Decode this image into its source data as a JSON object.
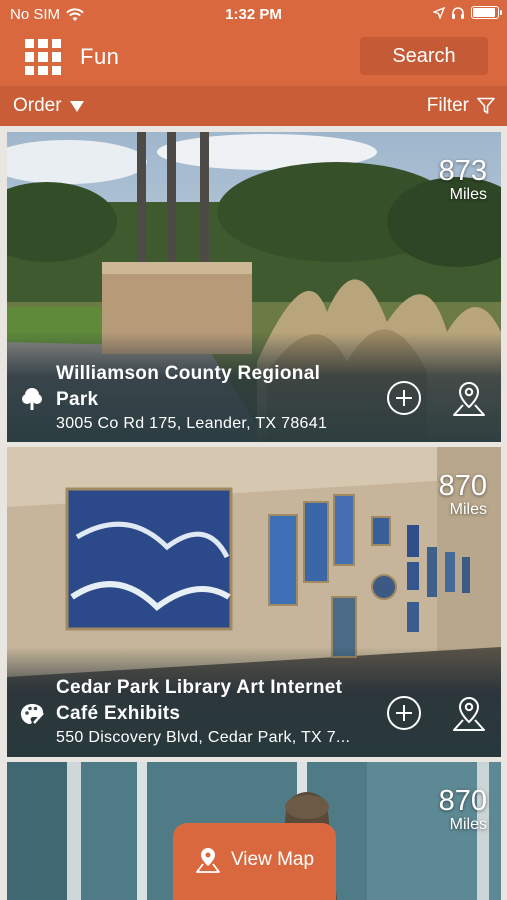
{
  "status_bar": {
    "carrier": "No SIM",
    "time": "1:32 PM"
  },
  "navbar": {
    "title": "Fun",
    "search_label": "Search"
  },
  "filter_bar": {
    "order_label": "Order",
    "filter_label": "Filter"
  },
  "listings": [
    {
      "name": "Williamson County Regional Park",
      "address": "3005 Co Rd 175, Leander, TX 78641",
      "distance": "873",
      "unit": "Miles",
      "category_icon": "tree-icon"
    },
    {
      "name": "Cedar Park Library Art Internet Café Exhibits",
      "address": "550 Discovery Blvd, Cedar Park, TX 7...",
      "distance": "870",
      "unit": "Miles",
      "category_icon": "palette-icon"
    },
    {
      "distance": "870",
      "unit": "Miles"
    }
  ],
  "view_map_label": "View Map",
  "colors": {
    "brand": "#d9683f",
    "filter_bar": "#c95d37",
    "search_button": "#c45a36"
  }
}
